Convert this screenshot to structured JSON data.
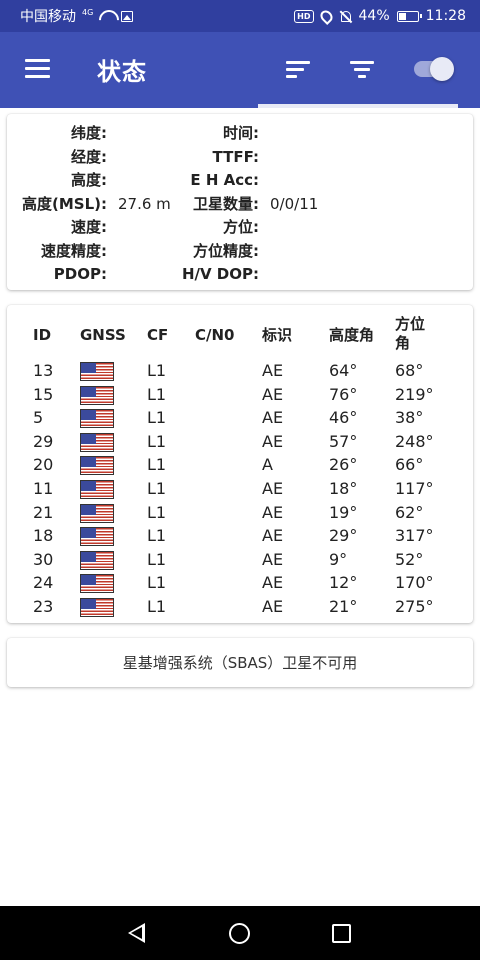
{
  "status_bar": {
    "carrier": "中国移动",
    "network_badge": "4G",
    "icons": [
      "wifi-icon",
      "image-icon",
      "hd-icon",
      "location-icon",
      "bell-off-icon",
      "battery-icon"
    ],
    "hd_label": "HD",
    "battery_percent_label": "44%",
    "battery_level": 0.44,
    "time": "11:28"
  },
  "app_bar": {
    "title": "状态",
    "icons": [
      "menu-icon",
      "sort-icon",
      "filter-icon",
      "toggle-switch"
    ],
    "toggle_on": true
  },
  "colors": {
    "status_bar": "#303F9F",
    "app_bar": "#3F51B5",
    "toggle_track": "#9fa8da",
    "nav_bar": "#000000"
  },
  "status": {
    "left": [
      {
        "label": "纬度:",
        "value": ""
      },
      {
        "label": "经度:",
        "value": ""
      },
      {
        "label": "高度:",
        "value": ""
      },
      {
        "label": "高度(MSL):",
        "value": "27.6 m"
      },
      {
        "label": "速度:",
        "value": ""
      },
      {
        "label": "速度精度:",
        "value": ""
      },
      {
        "label": "PDOP:",
        "value": ""
      }
    ],
    "right": [
      {
        "label": "时间:",
        "value": ""
      },
      {
        "label": "TTFF:",
        "value": ""
      },
      {
        "label": "E H Acc:",
        "value": ""
      },
      {
        "label": "卫星数量:",
        "value": "0/0/11"
      },
      {
        "label": "方位:",
        "value": ""
      },
      {
        "label": "方位精度:",
        "value": ""
      },
      {
        "label": "H/V DOP:",
        "value": ""
      }
    ]
  },
  "satellites": {
    "headers": {
      "id": "ID",
      "gnss": "GNSS",
      "cf": "CF",
      "cn0": "C/N0",
      "flags": "标识",
      "elevation": "高度角",
      "azimuth_line1": "方位",
      "azimuth_line2": "角"
    },
    "rows": [
      {
        "id": "13",
        "gnss": "us-flag-icon",
        "cf": "L1",
        "cn0": "",
        "flags": "AE",
        "elev": "64°",
        "azim": "68°"
      },
      {
        "id": "15",
        "gnss": "us-flag-icon",
        "cf": "L1",
        "cn0": "",
        "flags": "AE",
        "elev": "76°",
        "azim": "219°"
      },
      {
        "id": "5",
        "gnss": "us-flag-icon",
        "cf": "L1",
        "cn0": "",
        "flags": "AE",
        "elev": "46°",
        "azim": "38°"
      },
      {
        "id": "29",
        "gnss": "us-flag-icon",
        "cf": "L1",
        "cn0": "",
        "flags": "AE",
        "elev": "57°",
        "azim": "248°"
      },
      {
        "id": "20",
        "gnss": "us-flag-icon",
        "cf": "L1",
        "cn0": "",
        "flags": "A",
        "elev": "26°",
        "azim": "66°"
      },
      {
        "id": "11",
        "gnss": "us-flag-icon",
        "cf": "L1",
        "cn0": "",
        "flags": "AE",
        "elev": "18°",
        "azim": "117°"
      },
      {
        "id": "21",
        "gnss": "us-flag-icon",
        "cf": "L1",
        "cn0": "",
        "flags": "AE",
        "elev": "19°",
        "azim": "62°"
      },
      {
        "id": "18",
        "gnss": "us-flag-icon",
        "cf": "L1",
        "cn0": "",
        "flags": "AE",
        "elev": "29°",
        "azim": "317°"
      },
      {
        "id": "30",
        "gnss": "us-flag-icon",
        "cf": "L1",
        "cn0": "",
        "flags": "AE",
        "elev": "9°",
        "azim": "52°"
      },
      {
        "id": "24",
        "gnss": "us-flag-icon",
        "cf": "L1",
        "cn0": "",
        "flags": "AE",
        "elev": "12°",
        "azim": "170°"
      },
      {
        "id": "23",
        "gnss": "us-flag-icon",
        "cf": "L1",
        "cn0": "",
        "flags": "AE",
        "elev": "21°",
        "azim": "275°"
      }
    ]
  },
  "sbas": {
    "message": "星基增强系统（SBAS）卫星不可用"
  },
  "nav_bar": {
    "icons": [
      "back-icon",
      "home-icon",
      "recent-apps-icon"
    ]
  }
}
